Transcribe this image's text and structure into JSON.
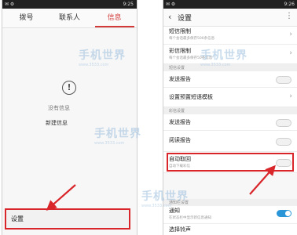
{
  "left_phone": {
    "status_time": "9:25",
    "tabs": [
      "拨号",
      "联系人",
      "信息"
    ],
    "active_tab": "信息",
    "empty_text": "没有信息",
    "new_message": "新建信息",
    "bottom_menu_item": "设置"
  },
  "right_phone": {
    "status_time": "9:26",
    "title": "设置",
    "rows": {
      "sms_limit": {
        "title": "短信限制",
        "desc": "每个会话最多保存500条信息"
      },
      "mms_limit": {
        "title": "彩信限制",
        "desc": "每个会话最多保存50条信息"
      },
      "section_sms": "短信设置",
      "delivery_report": {
        "title": "发送报告"
      },
      "preset_templates": {
        "title": "设置预置短语模板"
      },
      "section_mms": "彩信设置",
      "mms_delivery_report": {
        "title": "发送报告"
      },
      "read_report": {
        "title": "阅读报告"
      },
      "auto_retrieve": {
        "title": "自动取回",
        "desc": "自动下载彩信"
      },
      "section_notify": "通知栏设置",
      "notification": {
        "title": "通知",
        "desc": "在状态栏中显示新信息通知"
      },
      "ringtone": {
        "title": "选择铃声"
      }
    }
  },
  "watermark": {
    "brand": "手机世界",
    "url": "www.3533.com"
  },
  "colors": {
    "accent_red": "#d23a3a",
    "highlight_border": "#d9262b",
    "toggle_on": "#2a96d8"
  }
}
